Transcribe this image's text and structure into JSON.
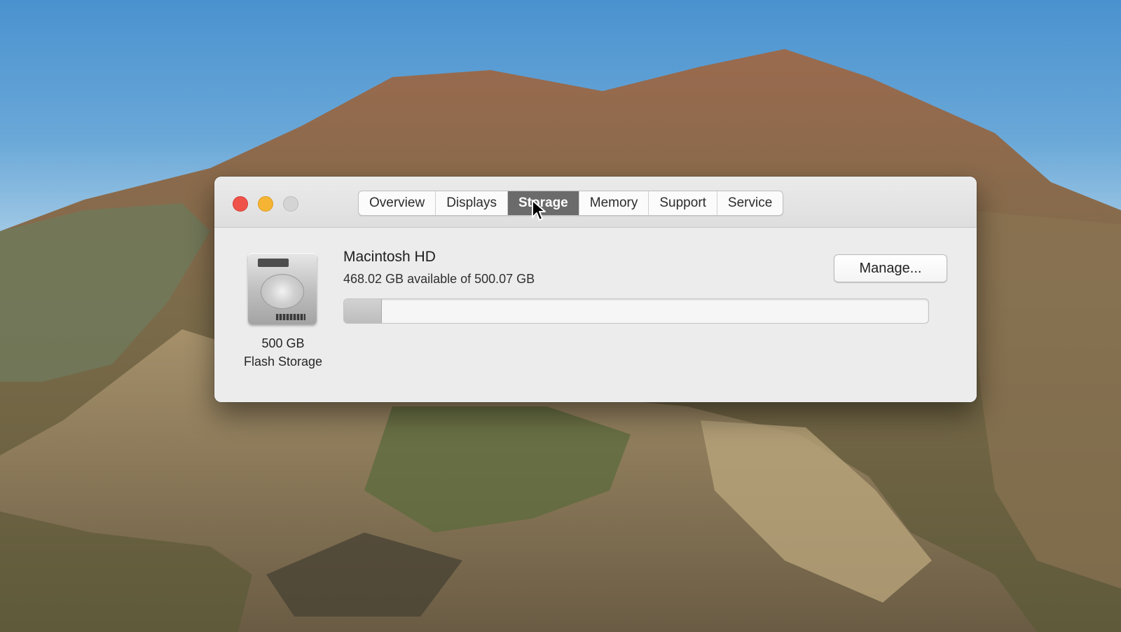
{
  "window": {
    "tabs": [
      {
        "label": "Overview",
        "active": false
      },
      {
        "label": "Displays",
        "active": false
      },
      {
        "label": "Storage",
        "active": true
      },
      {
        "label": "Memory",
        "active": false
      },
      {
        "label": "Support",
        "active": false
      },
      {
        "label": "Service",
        "active": false
      }
    ]
  },
  "storage": {
    "drive_icon": "hard-drive-icon",
    "capacity_line1": "500 GB",
    "capacity_line2": "Flash Storage",
    "volume_name": "Macintosh HD",
    "availability": "468.02 GB available of 500.07 GB",
    "used_fraction": 0.064,
    "manage_label": "Manage..."
  },
  "colors": {
    "close": "#ee5249",
    "minimize": "#f5b433",
    "zoom_disabled": "#d4d4d4",
    "active_tab": "#6b6b6b"
  }
}
